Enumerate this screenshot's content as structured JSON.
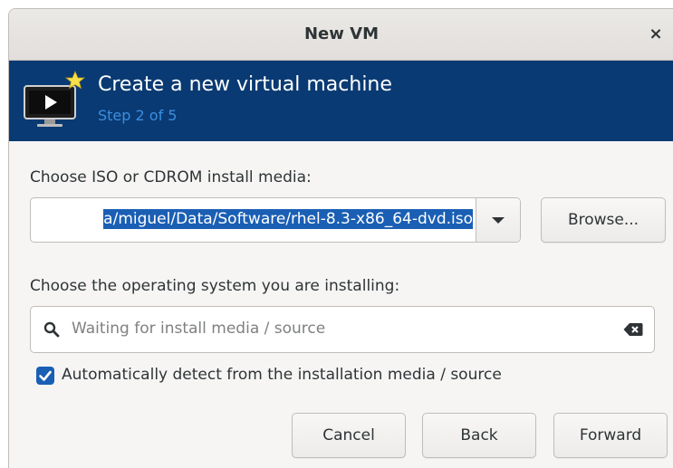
{
  "window": {
    "title": "New VM",
    "close_glyph": "×"
  },
  "banner": {
    "title": "Create a new virtual machine",
    "step": "Step 2 of 5",
    "icon": "vm-monitor-icon"
  },
  "media": {
    "label": "Choose ISO or CDROM install media:",
    "value": "a/miguel/Data/Software/rhel-8.3-x86_64-dvd.iso",
    "browse_label": "Browse..."
  },
  "os": {
    "label": "Choose the operating system you are installing:",
    "search_placeholder": "Waiting for install media / source",
    "auto_detect_label": "Automatically detect from the installation media / source",
    "auto_detect_checked": true
  },
  "buttons": {
    "cancel": "Cancel",
    "back": "Back",
    "forward": "Forward"
  },
  "colors": {
    "banner_bg": "#0a3a73",
    "banner_step": "#3b8ee0",
    "selection": "#1a5fb4",
    "checkbox": "#1a5fb4"
  }
}
